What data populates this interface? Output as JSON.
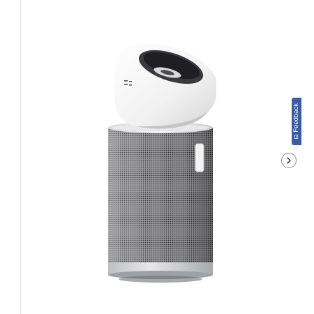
{
  "feedback_tab": {
    "label": "Feedback",
    "icon": "feedback-icon",
    "color": "#3b5ba5"
  },
  "carousel": {
    "next_icon": "chevron-right-icon",
    "image_subject": "air-purifier-product-image"
  }
}
